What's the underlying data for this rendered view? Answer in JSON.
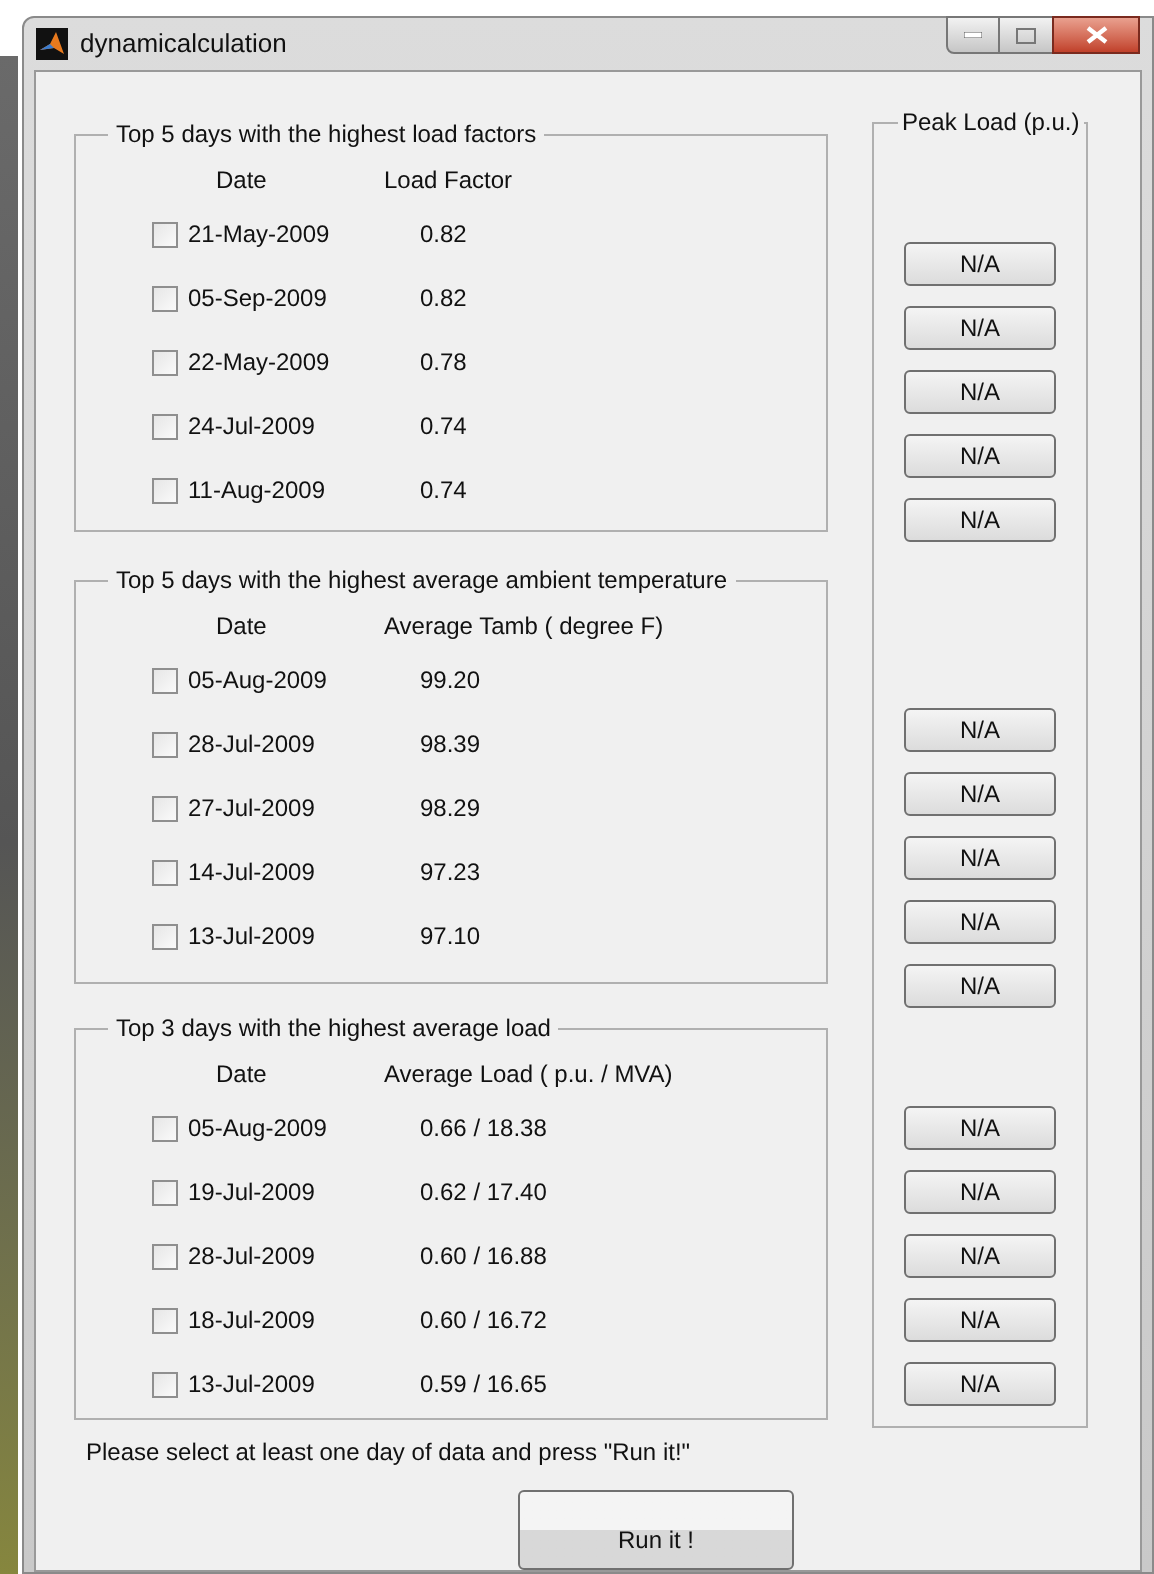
{
  "window": {
    "title": "dynamicalculation"
  },
  "sections": [
    {
      "legend": "Top 5 days with the highest load factors",
      "headers": [
        "Date",
        "Load Factor"
      ],
      "rows": [
        {
          "date": "21-May-2009",
          "value": "0.82",
          "checked": false,
          "peak": "N/A"
        },
        {
          "date": "05-Sep-2009",
          "value": "0.82",
          "checked": false,
          "peak": "N/A"
        },
        {
          "date": "22-May-2009",
          "value": "0.78",
          "checked": false,
          "peak": "N/A"
        },
        {
          "date": "24-Jul-2009",
          "value": "0.74",
          "checked": false,
          "peak": "N/A"
        },
        {
          "date": "11-Aug-2009",
          "value": "0.74",
          "checked": false,
          "peak": "N/A"
        }
      ]
    },
    {
      "legend": "Top 5 days with the highest average ambient temperature",
      "headers": [
        "Date",
        "Average Tamb ( degree F)"
      ],
      "rows": [
        {
          "date": "05-Aug-2009",
          "value": "99.20",
          "checked": false,
          "peak": "N/A"
        },
        {
          "date": "28-Jul-2009",
          "value": "98.39",
          "checked": false,
          "peak": "N/A"
        },
        {
          "date": "27-Jul-2009",
          "value": "98.29",
          "checked": false,
          "peak": "N/A"
        },
        {
          "date": "14-Jul-2009",
          "value": "97.23",
          "checked": false,
          "peak": "N/A"
        },
        {
          "date": "13-Jul-2009",
          "value": "97.10",
          "checked": false,
          "peak": "N/A"
        }
      ]
    },
    {
      "legend": "Top 3 days with the highest average load",
      "headers": [
        "Date",
        "Average Load ( p.u.  / MVA)"
      ],
      "rows": [
        {
          "date": "05-Aug-2009",
          "value": "0.66 / 18.38",
          "checked": false,
          "peak": "N/A"
        },
        {
          "date": "19-Jul-2009",
          "value": "0.62 / 17.40",
          "checked": false,
          "peak": "N/A"
        },
        {
          "date": "28-Jul-2009",
          "value": "0.60 / 16.88",
          "checked": false,
          "peak": "N/A"
        },
        {
          "date": "18-Jul-2009",
          "value": "0.60 / 16.72",
          "checked": false,
          "peak": "N/A"
        },
        {
          "date": "13-Jul-2009",
          "value": "0.59 / 16.65",
          "checked": false,
          "peak": "N/A"
        }
      ]
    }
  ],
  "peak_load": {
    "legend": "Peak Load (p.u.)"
  },
  "message": "Please select at least one day of data and press \"Run it!\"",
  "run_button": "Run it !"
}
